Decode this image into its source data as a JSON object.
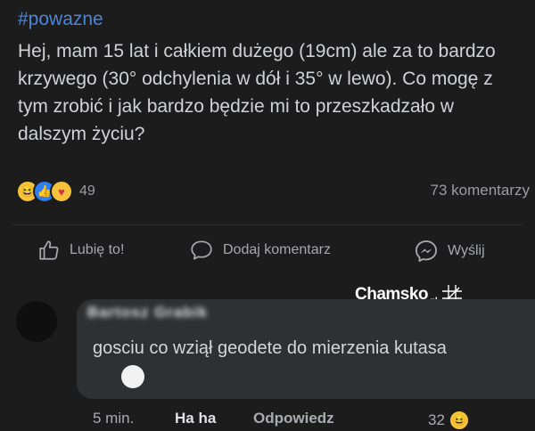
{
  "post": {
    "hashtag": "#powazne",
    "body": "Hej, mam 15 lat i całkiem dużego (19cm) ale za to bardzo krzywego (30° odchylenia w dół i 35° w lewo). Co mogę z tym zrobić i jak bardzo będzie mi to przeszkadzało w dalszym życiu?",
    "reaction_icons": [
      "haha-reaction-icon",
      "like-reaction-icon",
      "care-reaction-icon"
    ],
    "reaction_count": "49",
    "comment_count": "73 komentarzy"
  },
  "actions": {
    "like": "Lubię to!",
    "comment": "Dodaj komentarz",
    "send": "Wyślij"
  },
  "watermark": {
    "text": "Chamsko",
    "suffix": ".pl"
  },
  "comment": {
    "author": "Bartosz Grabik",
    "text": "gosciu co wziął geodete do mierzenia kutasa",
    "time": "5 min.",
    "reaction_label": "Ha ha",
    "reply_label": "Odpowiedz",
    "reaction_count": "32"
  },
  "colors": {
    "background": "#1c1c1d",
    "hashtag": "#4a86d8",
    "bubble": "#2e3032"
  }
}
